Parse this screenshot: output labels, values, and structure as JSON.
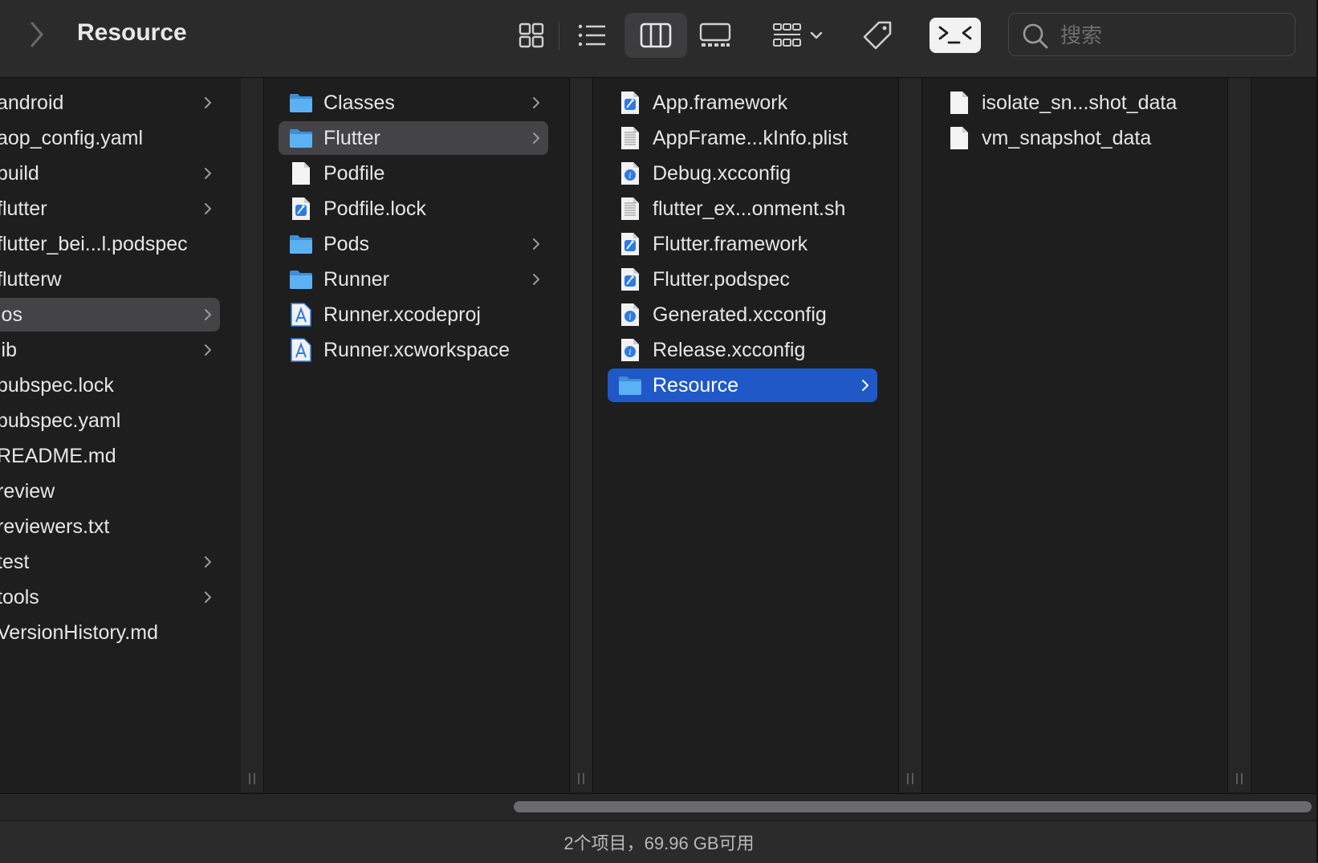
{
  "window": {
    "title": "Resource"
  },
  "toolbar": {
    "view_buttons": [
      "grid-view",
      "list-view",
      "column-view",
      "gallery-view"
    ],
    "active_view": "column-view",
    "group_button": "group-by",
    "tags_button": "tag",
    "terminal_button": "terminal"
  },
  "search": {
    "placeholder": "搜索",
    "value": ""
  },
  "columns": [
    {
      "items": [
        {
          "name": "android",
          "folder": true
        },
        {
          "name": "aop_config.yaml",
          "folder": false
        },
        {
          "name": "build",
          "folder": true
        },
        {
          "name": "flutter",
          "folder": true
        },
        {
          "name": "flutter_bei...l.podspec",
          "folder": false
        },
        {
          "name": "flutterw",
          "folder": false
        },
        {
          "name": "ios",
          "folder": true,
          "selected": "gray"
        },
        {
          "name": "lib",
          "folder": true
        },
        {
          "name": "pubspec.lock",
          "folder": false
        },
        {
          "name": "pubspec.yaml",
          "folder": false
        },
        {
          "name": "README.md",
          "folder": false
        },
        {
          "name": "review",
          "folder": false
        },
        {
          "name": "reviewers.txt",
          "folder": false
        },
        {
          "name": "test",
          "folder": true
        },
        {
          "name": "tools",
          "folder": true
        },
        {
          "name": "VersionHistory.md",
          "folder": false
        }
      ]
    },
    {
      "items": [
        {
          "name": "Classes",
          "icon": "folder-icon",
          "folder": true
        },
        {
          "name": "Flutter",
          "icon": "folder-icon",
          "folder": true,
          "selected": "gray"
        },
        {
          "name": "Podfile",
          "icon": "document-icon",
          "folder": false
        },
        {
          "name": "Podfile.lock",
          "icon": "xcode-file-icon",
          "folder": false
        },
        {
          "name": "Pods",
          "icon": "folder-icon",
          "folder": true
        },
        {
          "name": "Runner",
          "icon": "folder-icon",
          "folder": true
        },
        {
          "name": "Runner.xcodeproj",
          "icon": "xcodeproj-icon",
          "folder": false
        },
        {
          "name": "Runner.xcworkspace",
          "icon": "xcodeproj-icon",
          "folder": false
        }
      ]
    },
    {
      "items": [
        {
          "name": "App.framework",
          "icon": "xcode-file-icon",
          "folder": false
        },
        {
          "name": "AppFrame...kInfo.plist",
          "icon": "plist-icon",
          "folder": false
        },
        {
          "name": "Debug.xcconfig",
          "icon": "xcconfig-icon",
          "folder": false
        },
        {
          "name": "flutter_ex...onment.sh",
          "icon": "text-file-icon",
          "folder": false
        },
        {
          "name": "Flutter.framework",
          "icon": "xcode-file-icon",
          "folder": false
        },
        {
          "name": "Flutter.podspec",
          "icon": "xcode-file-icon",
          "folder": false
        },
        {
          "name": "Generated.xcconfig",
          "icon": "xcconfig-icon",
          "folder": false
        },
        {
          "name": "Release.xcconfig",
          "icon": "xcconfig-icon",
          "folder": false
        },
        {
          "name": "Resource",
          "icon": "folder-icon",
          "folder": true,
          "selected": "blue"
        }
      ]
    },
    {
      "items": [
        {
          "name": "isolate_sn...shot_data",
          "icon": "document-icon",
          "folder": false
        },
        {
          "name": "vm_snapshot_data",
          "icon": "document-icon",
          "folder": false
        }
      ]
    }
  ],
  "status": {
    "text": "2个项目，69.96 GB可用"
  },
  "colors": {
    "selection_blue": "#2058c8",
    "selection_gray": "#444446",
    "folder_blue": "#4aa3ee"
  }
}
